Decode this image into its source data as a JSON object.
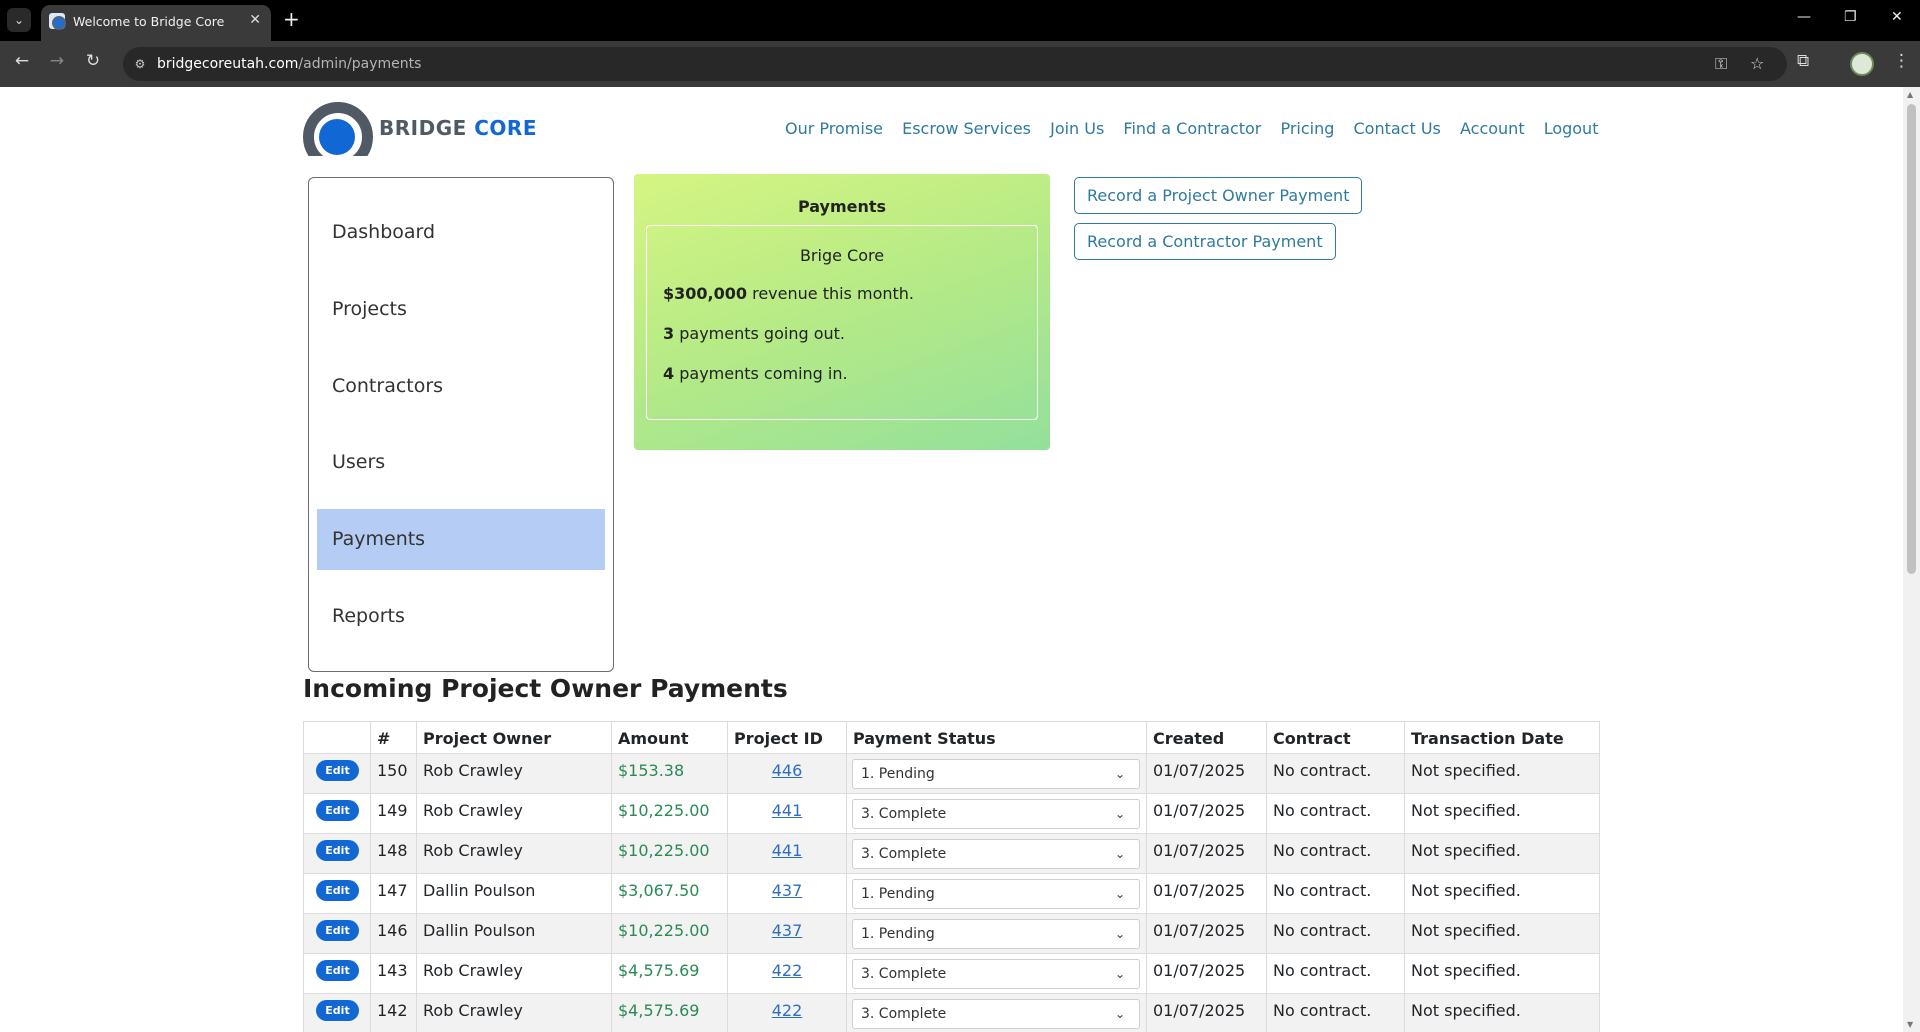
{
  "browser": {
    "tab_title": "Welcome to Bridge Core",
    "url_host": "bridgecoreutah.com",
    "url_path": "/admin/payments"
  },
  "logo": {
    "part1": "BRIDGE",
    "part2": "CORE"
  },
  "nav": [
    "Our Promise",
    "Escrow Services",
    "Join Us",
    "Find a Contractor",
    "Pricing",
    "Contact Us",
    "Account",
    "Logout"
  ],
  "sidebar": {
    "items": [
      {
        "label": "Dashboard",
        "active": false
      },
      {
        "label": "Projects",
        "active": false
      },
      {
        "label": "Contractors",
        "active": false
      },
      {
        "label": "Users",
        "active": false
      },
      {
        "label": "Payments",
        "active": true
      },
      {
        "label": "Reports",
        "active": false
      }
    ]
  },
  "stats": {
    "title": "Payments",
    "company": "Brige Core",
    "revenue_value": "$300,000",
    "revenue_text": " revenue this month.",
    "out_value": "3",
    "out_text": " payments going out.",
    "in_value": "4",
    "in_text": " payments coming in."
  },
  "actions": {
    "owner_payment": "Record a Project Owner Payment",
    "contractor_payment": "Record a Contractor Payment"
  },
  "section_title": "Incoming Project Owner Payments",
  "table": {
    "headers": [
      "",
      "#",
      "Project Owner",
      "Amount",
      "Project ID",
      "Payment Status",
      "Created",
      "Contract",
      "Transaction Date"
    ],
    "edit_label": "Edit",
    "rows": [
      {
        "id": "150",
        "owner": "Rob Crawley",
        "amount": "$153.38",
        "project_id": "446",
        "status": "1. Pending",
        "created": "01/07/2025",
        "contract": "No contract.",
        "transaction_date": "Not specified."
      },
      {
        "id": "149",
        "owner": "Rob Crawley",
        "amount": "$10,225.00",
        "project_id": "441",
        "status": "3. Complete",
        "created": "01/07/2025",
        "contract": "No contract.",
        "transaction_date": "Not specified."
      },
      {
        "id": "148",
        "owner": "Rob Crawley",
        "amount": "$10,225.00",
        "project_id": "441",
        "status": "3. Complete",
        "created": "01/07/2025",
        "contract": "No contract.",
        "transaction_date": "Not specified."
      },
      {
        "id": "147",
        "owner": "Dallin Poulson",
        "amount": "$3,067.50",
        "project_id": "437",
        "status": "1. Pending",
        "created": "01/07/2025",
        "contract": "No contract.",
        "transaction_date": "Not specified."
      },
      {
        "id": "146",
        "owner": "Dallin Poulson",
        "amount": "$10,225.00",
        "project_id": "437",
        "status": "1. Pending",
        "created": "01/07/2025",
        "contract": "No contract.",
        "transaction_date": "Not specified."
      },
      {
        "id": "143",
        "owner": "Rob Crawley",
        "amount": "$4,575.69",
        "project_id": "422",
        "status": "3. Complete",
        "created": "01/07/2025",
        "contract": "No contract.",
        "transaction_date": "Not specified."
      },
      {
        "id": "142",
        "owner": "Rob Crawley",
        "amount": "$4,575.69",
        "project_id": "422",
        "status": "3. Complete",
        "created": "01/07/2025",
        "contract": "No contract.",
        "transaction_date": "Not specified."
      }
    ]
  },
  "colors": {
    "brand_blue": "#1167d4",
    "nav_link": "#2f7a9f",
    "amount_green": "#2a8a55",
    "active_sidebar": "#b5cdf4"
  }
}
